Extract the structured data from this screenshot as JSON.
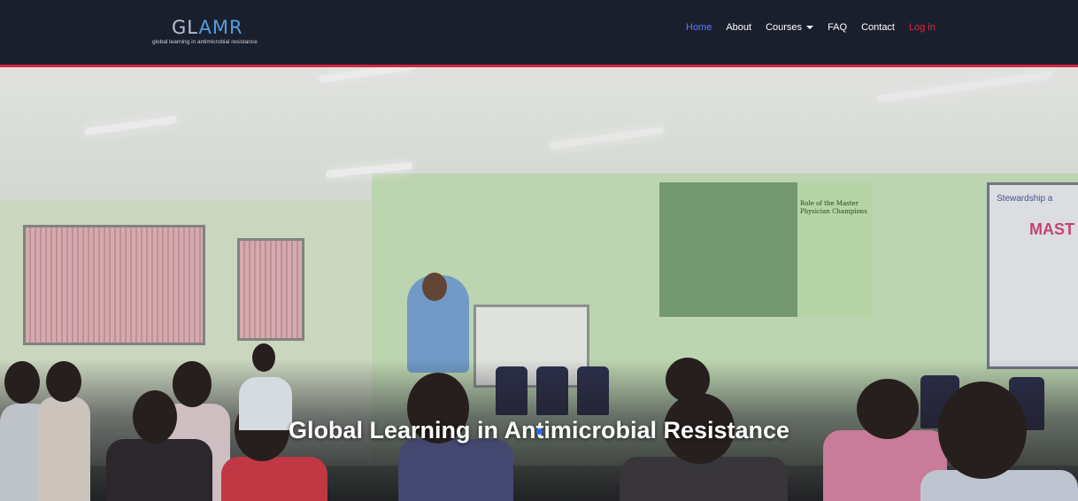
{
  "brand": {
    "name_part1": "GL",
    "name_part2": "AMR",
    "tagline": "global learning in antimicrobial resistance"
  },
  "nav": {
    "home": "Home",
    "about": "About",
    "courses": "Courses",
    "faq": "FAQ",
    "contact": "Contact",
    "login": "Log in"
  },
  "hero": {
    "title": "Global Learning in Antimicrobial Resistance",
    "image_text": {
      "slide_heading": "Role of the Master Physician Champions",
      "banner_heading": "Stewardship a",
      "banner_big": "MAST"
    }
  },
  "colors": {
    "navbar_bg": "#1a1f2e",
    "accent_red": "#d6243c",
    "active_link": "#5c77ff",
    "login_link": "#e5263f"
  },
  "icons": {
    "courses_dropdown": "caret-down-icon"
  }
}
